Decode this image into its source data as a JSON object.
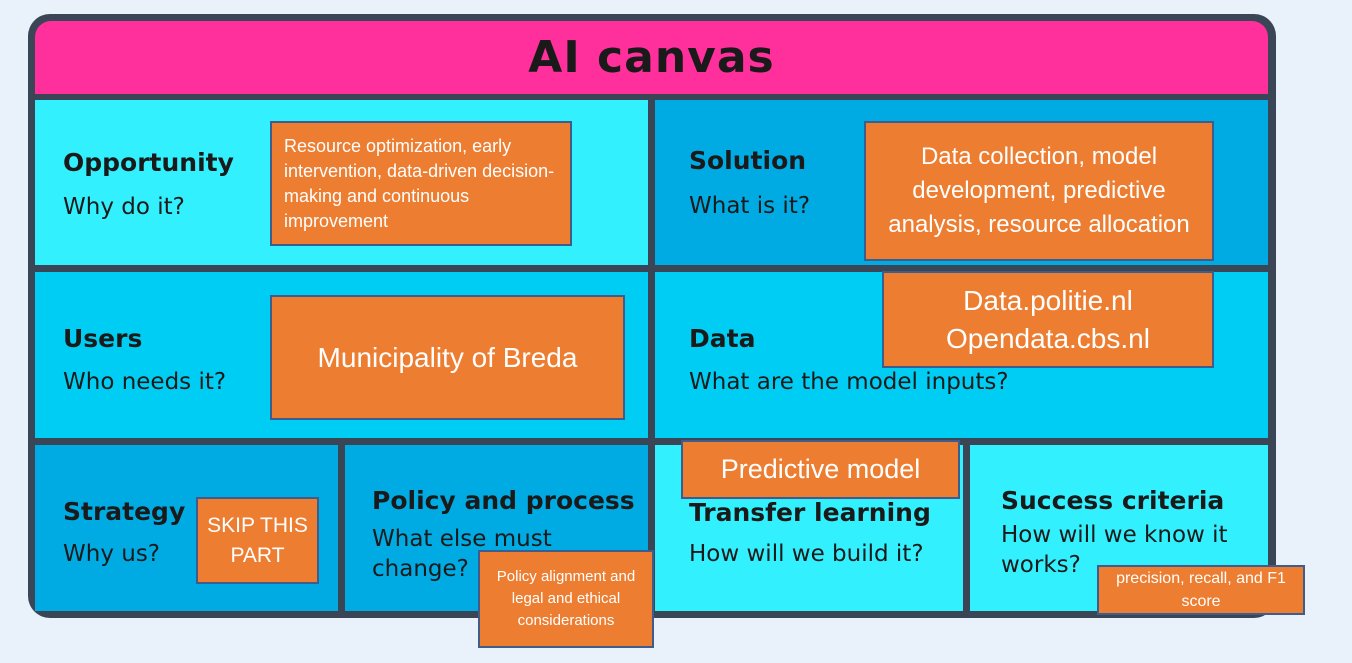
{
  "title": "AI canvas",
  "cells": {
    "opportunity": {
      "heading": "Opportunity",
      "question": "Why do it?"
    },
    "solution": {
      "heading": "Solution",
      "question": "What is it?"
    },
    "users": {
      "heading": "Users",
      "question": "Who needs it?"
    },
    "data": {
      "heading": "Data",
      "question": "What are the model inputs?"
    },
    "strategy": {
      "heading": "Strategy",
      "question": "Why us?"
    },
    "policy": {
      "heading": "Policy and process",
      "question": "What else must change?"
    },
    "transfer": {
      "heading": "Transfer learning",
      "question": "How will we build it?"
    },
    "success": {
      "heading": "Success criteria",
      "question": "How will we know it works?"
    }
  },
  "notes": {
    "opportunity": "Resource optimization, early intervention, data-driven decision-making and continuous improvement",
    "solution": "Data collection, model development, predictive analysis, resource allocation",
    "users": "Municipality of Breda",
    "data_line1": "Data.politie.nl",
    "data_line2": "Opendata.cbs.nl",
    "strategy": "SKIP THIS PART",
    "policy": "Policy alignment and legal and ethical considerations",
    "transfer": "Predictive model",
    "success": "precision, recall, and F1 score"
  },
  "colors": {
    "title_bar": "#ff2f9c",
    "frame": "#3a4656",
    "cell_light": "#33f0ff",
    "cell_mid": "#00cdf3",
    "cell_dark": "#00abe4",
    "note_fill": "#ed7d31",
    "note_border": "#3e5d8c"
  }
}
